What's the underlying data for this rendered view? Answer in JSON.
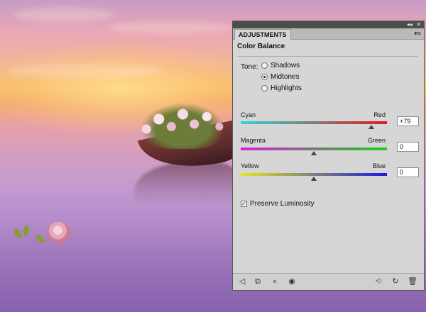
{
  "panel": {
    "tab_label": "ADJUSTMENTS",
    "collapse_icon": "double-chevron-left-icon",
    "close_icon": "close-icon",
    "menu_icon": "panel-menu-icon",
    "heading": "Color Balance"
  },
  "tone": {
    "label": "Tone:",
    "options": [
      {
        "label": "Shadows",
        "selected": false
      },
      {
        "label": "Midtones",
        "selected": true
      },
      {
        "label": "Highlights",
        "selected": false
      }
    ]
  },
  "sliders": [
    {
      "left": "Cyan",
      "right": "Red",
      "value": "+79",
      "range": [
        -100,
        100
      ],
      "left_color": "#2fd6d6",
      "right_color": "#e01b1b"
    },
    {
      "left": "Magenta",
      "right": "Green",
      "value": "0",
      "range": [
        -100,
        100
      ],
      "left_color": "#e01be0",
      "right_color": "#1bd01b"
    },
    {
      "left": "Yellow",
      "right": "Blue",
      "value": "0",
      "range": [
        -100,
        100
      ],
      "left_color": "#e6e61b",
      "right_color": "#1b1be0"
    }
  ],
  "preserve": {
    "label": "Preserve Luminosity",
    "checked": true
  },
  "bottom_icons": [
    "back-arrow-icon",
    "clip-to-layer-icon",
    "visibility-icon-gray",
    "eye-icon",
    "previous-state-icon",
    "reset-icon",
    "trash-icon"
  ]
}
